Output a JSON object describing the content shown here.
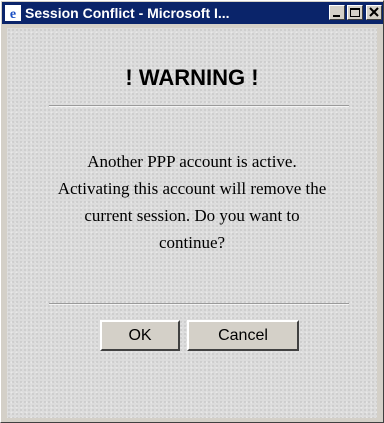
{
  "window": {
    "title": "Session Conflict - Microsoft I...",
    "controls": {
      "minimize_icon": "minimize-icon",
      "maximize_icon": "maximize-icon",
      "close_icon": "close-icon"
    }
  },
  "dialog": {
    "heading": "! WARNING !",
    "message_lines": [
      "Another PPP account is active.",
      "Activating this account will remove the",
      "current session. Do you want to",
      "continue?"
    ],
    "buttons": {
      "ok_label": "OK",
      "cancel_label": "Cancel"
    }
  },
  "colors": {
    "titlebar": "#0a246a",
    "face": "#d4d0c8"
  }
}
